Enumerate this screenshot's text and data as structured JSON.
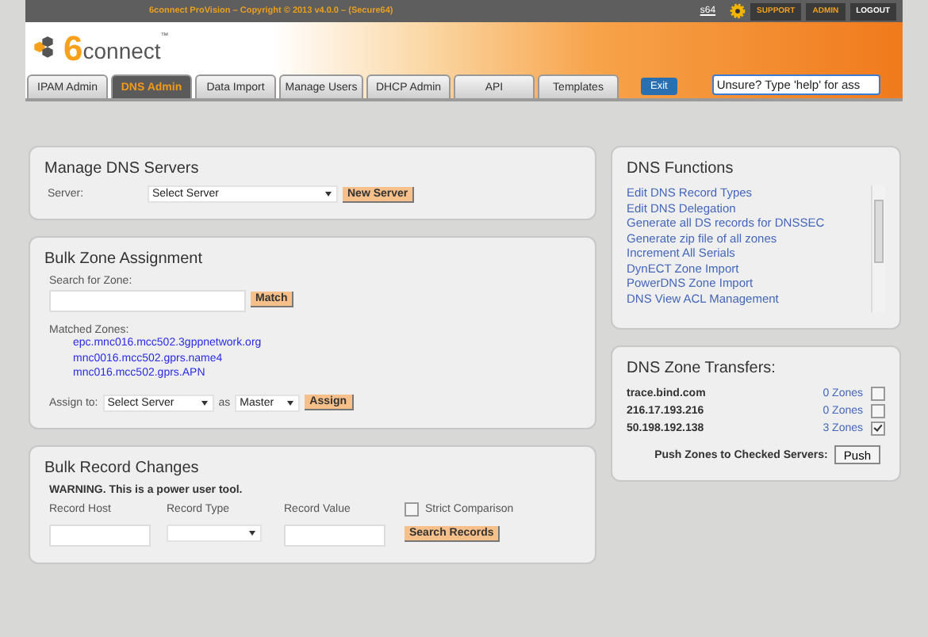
{
  "top_bar": {
    "copyright": "6connect ProVision – Copyright © 2013 v4.0.0 – (Secure64)",
    "user": "s64",
    "buttons": [
      "SUPPORT",
      "ADMIN",
      "LOGOUT"
    ]
  },
  "logo": {
    "digit": "6",
    "word": "connect",
    "tm": "™"
  },
  "tabs": [
    {
      "label": "IPAM Admin",
      "selected": false
    },
    {
      "label": "DNS Admin",
      "selected": true
    },
    {
      "label": "Data Import",
      "selected": false
    },
    {
      "label": "Manage Users",
      "selected": false
    },
    {
      "label": "DHCP Admin",
      "selected": false
    },
    {
      "label": "API",
      "selected": false
    },
    {
      "label": "Templates",
      "selected": false
    }
  ],
  "exit_button": "Exit",
  "help_field": {
    "value": "Unsure? Type 'help' for ass"
  },
  "manage_dns": {
    "title": "Manage DNS Servers",
    "server_label": "Server:",
    "server_select": "Select Server",
    "new_button": "New Server"
  },
  "bulk_zone": {
    "title": "Bulk Zone Assignment",
    "search_label": "Search for Zone:",
    "match_button": "Match",
    "matched_label": "Matched Zones:",
    "zones": [
      "epc.mnc016.mcc502.3gppnetwork.org",
      "mnc0016.mcc502.gprs.name4",
      "mnc016.mcc502.gprs.APN"
    ],
    "assign_label": "Assign to:",
    "assign_select": "Select Server",
    "as_label": "as",
    "role_select": "Master",
    "assign_button": "Assign"
  },
  "bulk_record": {
    "title": "Bulk Record Changes",
    "warning": "WARNING. This is a power user tool.",
    "host_label": "Record Host",
    "type_label": "Record Type",
    "value_label": "Record Value",
    "strict": {
      "label": "Strict Comparison",
      "checked": false
    },
    "search_button": "Search Records"
  },
  "dns_functions": {
    "title": "DNS Functions",
    "items": [
      "Edit DNS Record Types",
      "Edit DNS Delegation",
      "Generate all DS records for DNSSEC",
      "Generate zip file of all zones",
      "Increment All Serials",
      "DynECT Zone Import",
      "PowerDNS Zone Import",
      "DNS View ACL Management"
    ]
  },
  "zone_transfers": {
    "title": "DNS Zone Transfers:",
    "servers": [
      {
        "name": "trace.bind.com",
        "zones": "0 Zones",
        "checked": false
      },
      {
        "name": "216.17.193.216",
        "zones": "0 Zones",
        "checked": false
      },
      {
        "name": "50.198.192.138",
        "zones": "3 Zones",
        "checked": true
      }
    ],
    "push_label": "Push Zones to Checked Servers:",
    "push_button": "Push"
  }
}
